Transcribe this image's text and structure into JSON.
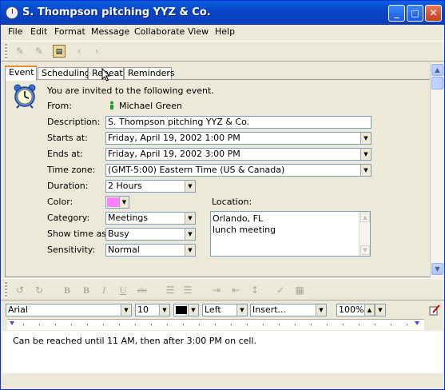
{
  "window": {
    "title": "S. Thompson pitching YYZ & Co.",
    "minimize": "_",
    "maximize": "□",
    "close": "✕"
  },
  "menu": [
    "File",
    "Edit",
    "Format",
    "Message",
    "Collaborate",
    "View",
    "Help"
  ],
  "tabs": [
    "Event",
    "Scheduling",
    "Repeat",
    "Reminders"
  ],
  "active_tab": "Event",
  "event": {
    "intro": "You are invited to the following event.",
    "from_label": "From:",
    "from_value": "Michael Green",
    "description_label": "Description:",
    "description_value": "S. Thompson pitching YYZ & Co.",
    "starts_label": "Starts at:",
    "starts_value": "Friday, April 19, 2002 1:00 PM",
    "ends_label": "Ends at:",
    "ends_value": "Friday, April 19, 2002 3:00 PM",
    "timezone_label": "Time zone:",
    "timezone_value": "(GMT-5:00) Eastern Time (US & Canada)",
    "duration_label": "Duration:",
    "duration_value": "2 Hours",
    "color_label": "Color:",
    "color_value": "#ff80ff",
    "category_label": "Category:",
    "category_value": "Meetings",
    "showtime_label": "Show time as:",
    "showtime_value": "Busy",
    "sensitivity_label": "Sensitivity:",
    "sensitivity_value": "Normal",
    "location_label": "Location:",
    "location_line1": "Orlando, FL",
    "location_line2": "lunch meeting"
  },
  "format": {
    "font": "Arial",
    "size": "10",
    "align": "Left",
    "insert": "Insert...",
    "zoom": "100%"
  },
  "notes": "Can be reached until 11 AM, then after 3:00 PM on cell."
}
